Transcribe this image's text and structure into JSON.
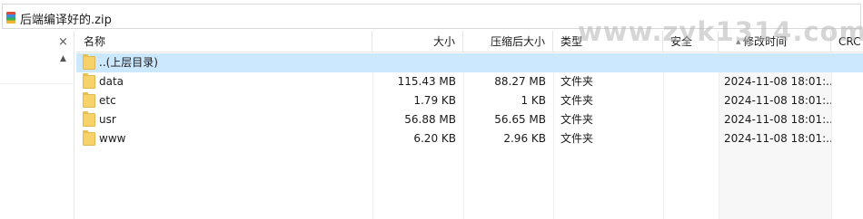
{
  "window": {
    "path_title": "后端编译好的.zip"
  },
  "left_pane": {
    "close_symbol": "×",
    "scroll_up_symbol": "▲"
  },
  "columns": {
    "name": "名称",
    "size": "大小",
    "compressed": "压缩后大小",
    "type": "类型",
    "security": "安全",
    "modified": "修改时间",
    "crc": "CRC"
  },
  "rows": [
    {
      "name": "..(上层目录)",
      "size": "",
      "compressed": "",
      "type": "",
      "modified": ""
    },
    {
      "name": "data",
      "size": "115.43 MB",
      "compressed": "88.27 MB",
      "type": "文件夹",
      "modified": "2024-11-08 18:01:..."
    },
    {
      "name": "etc",
      "size": "1.79 KB",
      "compressed": "1 KB",
      "type": "文件夹",
      "modified": "2024-11-08 18:01:..."
    },
    {
      "name": "usr",
      "size": "56.88 MB",
      "compressed": "56.65 MB",
      "type": "文件夹",
      "modified": "2024-11-08 18:01:..."
    },
    {
      "name": "www",
      "size": "6.20 KB",
      "compressed": "2.96 KB",
      "type": "文件夹",
      "modified": "2024-11-08 18:01:..."
    }
  ],
  "watermark": "www.zyk1314.com",
  "colors": {
    "selected_row": "#cce8ff",
    "folder": "#f7d26a"
  }
}
